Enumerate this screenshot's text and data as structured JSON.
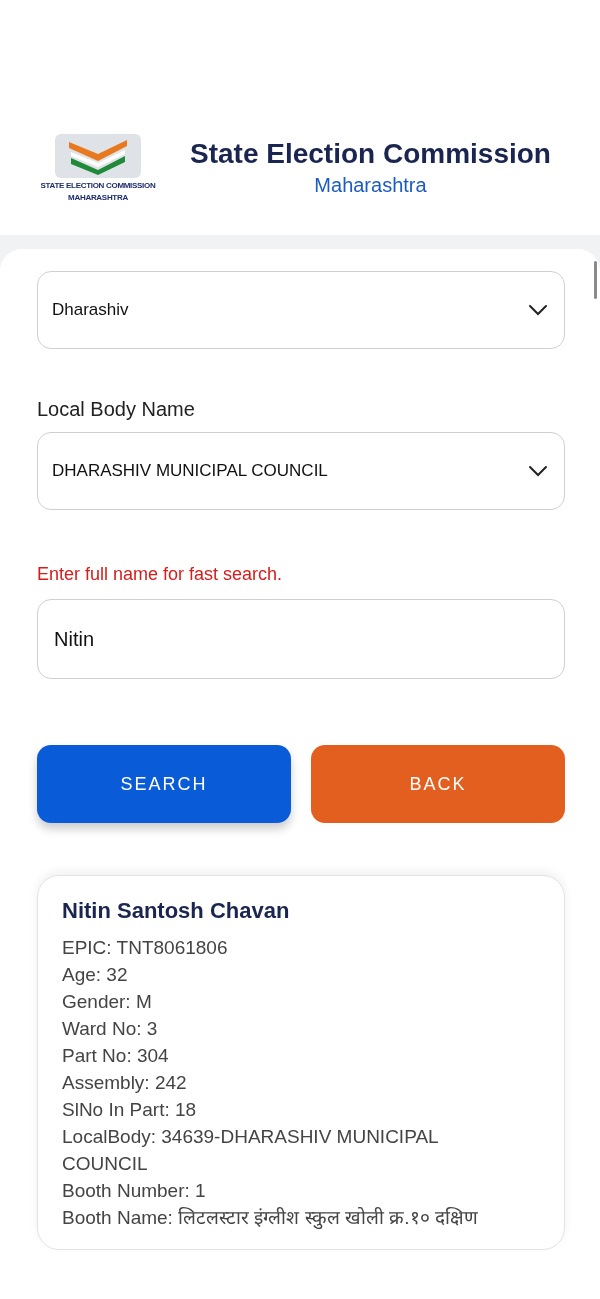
{
  "header": {
    "logo_caption": [
      "STATE ELECTION COMMISSION",
      "MAHARASHTRA"
    ],
    "title": "State Election Commission",
    "subtitle": "Maharashtra"
  },
  "form": {
    "district": {
      "value": "Dharashiv"
    },
    "local_body": {
      "label": "Local Body Name",
      "value": "DHARASHIV MUNICIPAL COUNCIL"
    },
    "hint": "Enter full name for fast search.",
    "name_input": {
      "value": "Nitin"
    },
    "buttons": [
      {
        "label": "SEARCH",
        "kind": "primary"
      },
      {
        "label": "BACK",
        "kind": "secondary"
      }
    ]
  },
  "result": {
    "name": "Nitin Santosh Chavan",
    "details": [
      "EPIC: TNT8061806",
      "Age: 32",
      "Gender: M",
      "Ward No: 3",
      "Part No: 304",
      "Assembly: 242",
      "SlNo In Part: 18",
      "LocalBody: 34639-DHARASHIV MUNICIPAL COUNCIL",
      "Booth Number: 1",
      "Booth Name: लिटलस्टार इंग्लीश स्कुल खोली क्र.१० दक्षिण"
    ]
  }
}
